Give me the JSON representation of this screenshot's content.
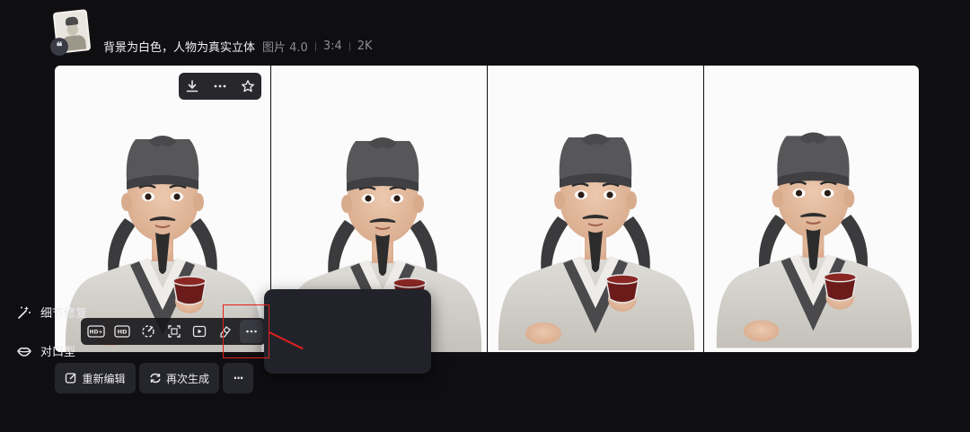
{
  "header": {
    "avatar_icon": "portrait-thumbnail",
    "badge_icon": "quote-icon",
    "badge_glyph": "❝",
    "prompt": "背景为白色，人物为真实立体",
    "model": "图片 4.0",
    "ratio": "3:4",
    "resolution": "2K"
  },
  "images": {
    "count": 4,
    "background": "#fbfbfb"
  },
  "image_toolbar": {
    "download_icon": "download-icon",
    "more_icon": "more-icon",
    "favorite_icon": "star-icon"
  },
  "bottom_tools": {
    "hd_plus_label": "HD+",
    "hd_label": "HD",
    "icons": [
      "hd-plus-icon",
      "hd-icon",
      "palette-icon",
      "crop-expand-icon",
      "play-icon",
      "eraser-icon",
      "more-icon"
    ]
  },
  "popup_menu": {
    "items": [
      {
        "label": "细节修复",
        "icon": "magic-wand-icon"
      },
      {
        "label": "对口型",
        "icon": "lips-icon"
      }
    ]
  },
  "actions": {
    "reedit_label": "重新编辑",
    "regenerate_label": "再次生成",
    "more_glyph": "···"
  },
  "colors": {
    "background": "#0f0f12",
    "menu_bg": "#22232a",
    "highlight": "#e0201f"
  }
}
